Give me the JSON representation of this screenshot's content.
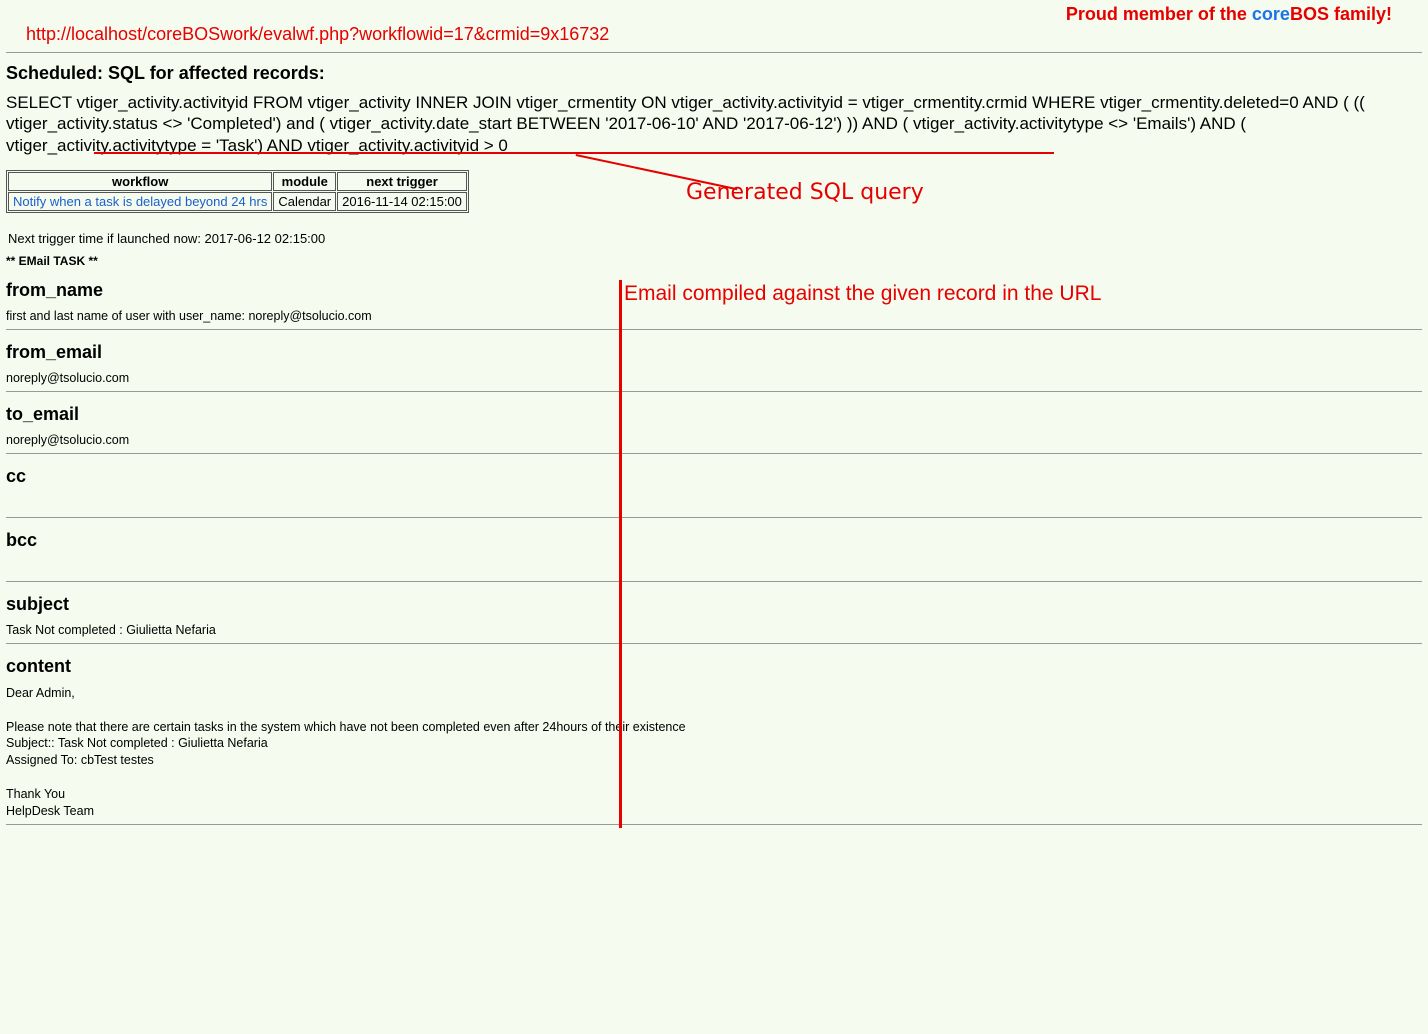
{
  "topbar": {
    "url": "http://localhost/coreBOSwork/evalwf.php?workflowid=17&crmid=9x16732",
    "proud_prefix": "Proud member of the ",
    "proud_core": "core",
    "proud_bos": "BOS",
    "proud_suffix": " family!"
  },
  "sql_section": {
    "title": "Scheduled: SQL for affected records:",
    "query": "SELECT vtiger_activity.activityid FROM vtiger_activity INNER JOIN vtiger_crmentity ON vtiger_activity.activityid = vtiger_crmentity.crmid WHERE vtiger_crmentity.deleted=0 AND ( (( vtiger_activity.status <> 'Completed') and ( vtiger_activity.date_start BETWEEN '2017-06-10' AND '2017-06-12') )) AND ( vtiger_activity.activitytype <> 'Emails') AND ( vtiger_activity.activitytype = 'Task') AND vtiger_activity.activityid > 0"
  },
  "annotation": {
    "sql": "Generated SQL query",
    "email": "Email compiled against the given record in the URL"
  },
  "wf_table": {
    "headers": {
      "c1": "workflow",
      "c2": "module",
      "c3": "next trigger"
    },
    "row": {
      "workflow_link": "Notify when a task is delayed beyond 24 hrs",
      "module": "Calendar",
      "next_trigger": "2016-11-14 02:15:00"
    }
  },
  "next_trigger_text": "Next trigger time if launched now: 2017-06-12 02:15:00",
  "task_marker": "** EMail TASK **",
  "email": {
    "from_name": {
      "label": "from_name",
      "value": "first and last name of user with user_name: noreply@tsolucio.com"
    },
    "from_email": {
      "label": "from_email",
      "value": "noreply@tsolucio.com"
    },
    "to_email": {
      "label": "to_email",
      "value": "noreply@tsolucio.com"
    },
    "cc": {
      "label": "cc",
      "value": ""
    },
    "bcc": {
      "label": "bcc",
      "value": ""
    },
    "subject": {
      "label": "subject",
      "value": "Task Not completed : Giulietta Nefaria"
    },
    "content": {
      "label": "content",
      "body": "Dear Admin,\n\nPlease note that there are certain tasks in the system which have not been completed even after 24hours of their existence\nSubject:: Task Not completed : Giulietta Nefaria\nAssigned To: cbTest testes\n\nThank You\nHelpDesk Team"
    }
  }
}
